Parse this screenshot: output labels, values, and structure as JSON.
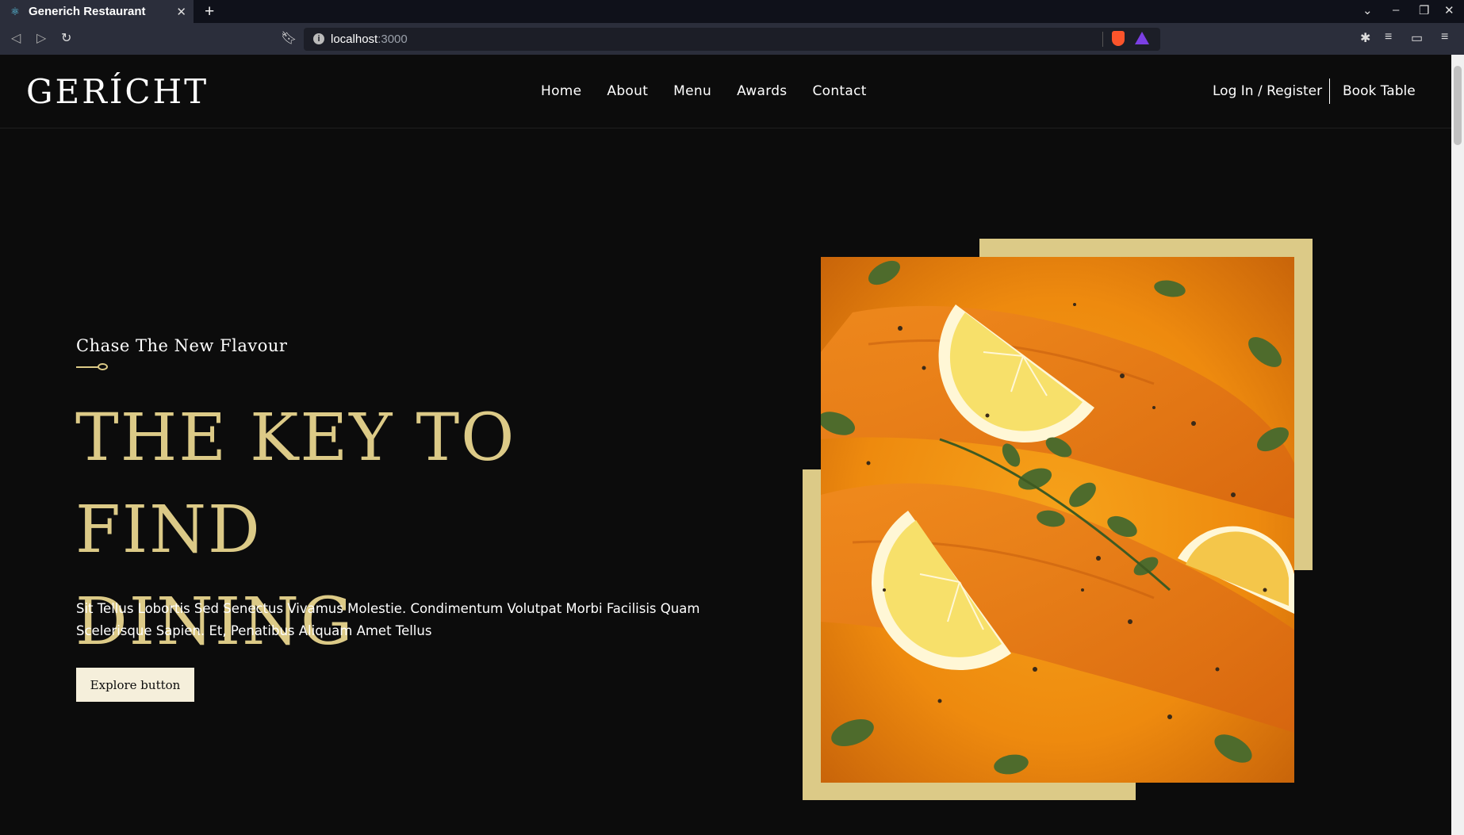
{
  "browser": {
    "tab_title": "Generich Restaurant",
    "url_host": "localhost",
    "url_port": ":3000"
  },
  "navbar": {
    "logo": "GERÍCHT",
    "links": [
      "Home",
      "About",
      "Menu",
      "Awards",
      "Contact"
    ],
    "login": "Log In / Register",
    "book": "Book Table"
  },
  "hero": {
    "subtitle": "Chase The New Flavour",
    "headline_line1": "THE KEY TO FIND",
    "headline_line2": "DINING",
    "description": "Sit Tellus Lobortis Sed Senectus Vivamus Molestie. Condimentum Volutpat Morbi Facilisis Quam Scelerisque Sapien. Et, Penatibus Aliquam Amet Tellus",
    "button": "Explore button"
  },
  "colors": {
    "gold": "#dcca87",
    "background": "#0c0c0c",
    "button_bg": "#f5efdb"
  }
}
